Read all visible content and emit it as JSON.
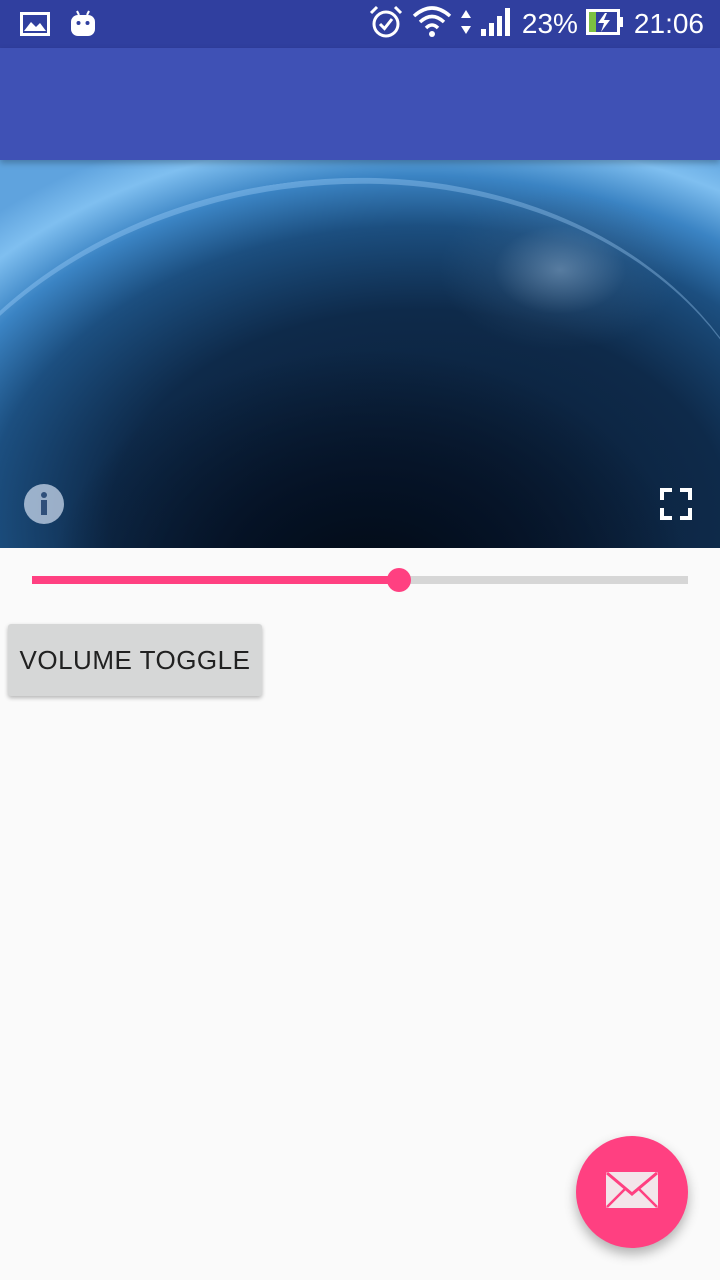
{
  "status_bar": {
    "notification_icons": [
      "gallery-icon",
      "android-icon"
    ],
    "status_icons": [
      "alarm-icon",
      "wifi-icon",
      "data-arrows-icon",
      "signal-icon",
      "battery-charging-icon"
    ],
    "battery_percent": "23%",
    "time": "21:06"
  },
  "app_bar": {
    "color": "#3f51b5"
  },
  "video_player": {
    "info_icon": "info-icon",
    "fullscreen_icon": "fullscreen-icon"
  },
  "seekbar": {
    "progress": 0.56,
    "accent": "#ff4081"
  },
  "volume_toggle": {
    "label": "VOLUME TOGGLE"
  },
  "fab": {
    "icon": "email-icon",
    "color": "#ff4081"
  }
}
